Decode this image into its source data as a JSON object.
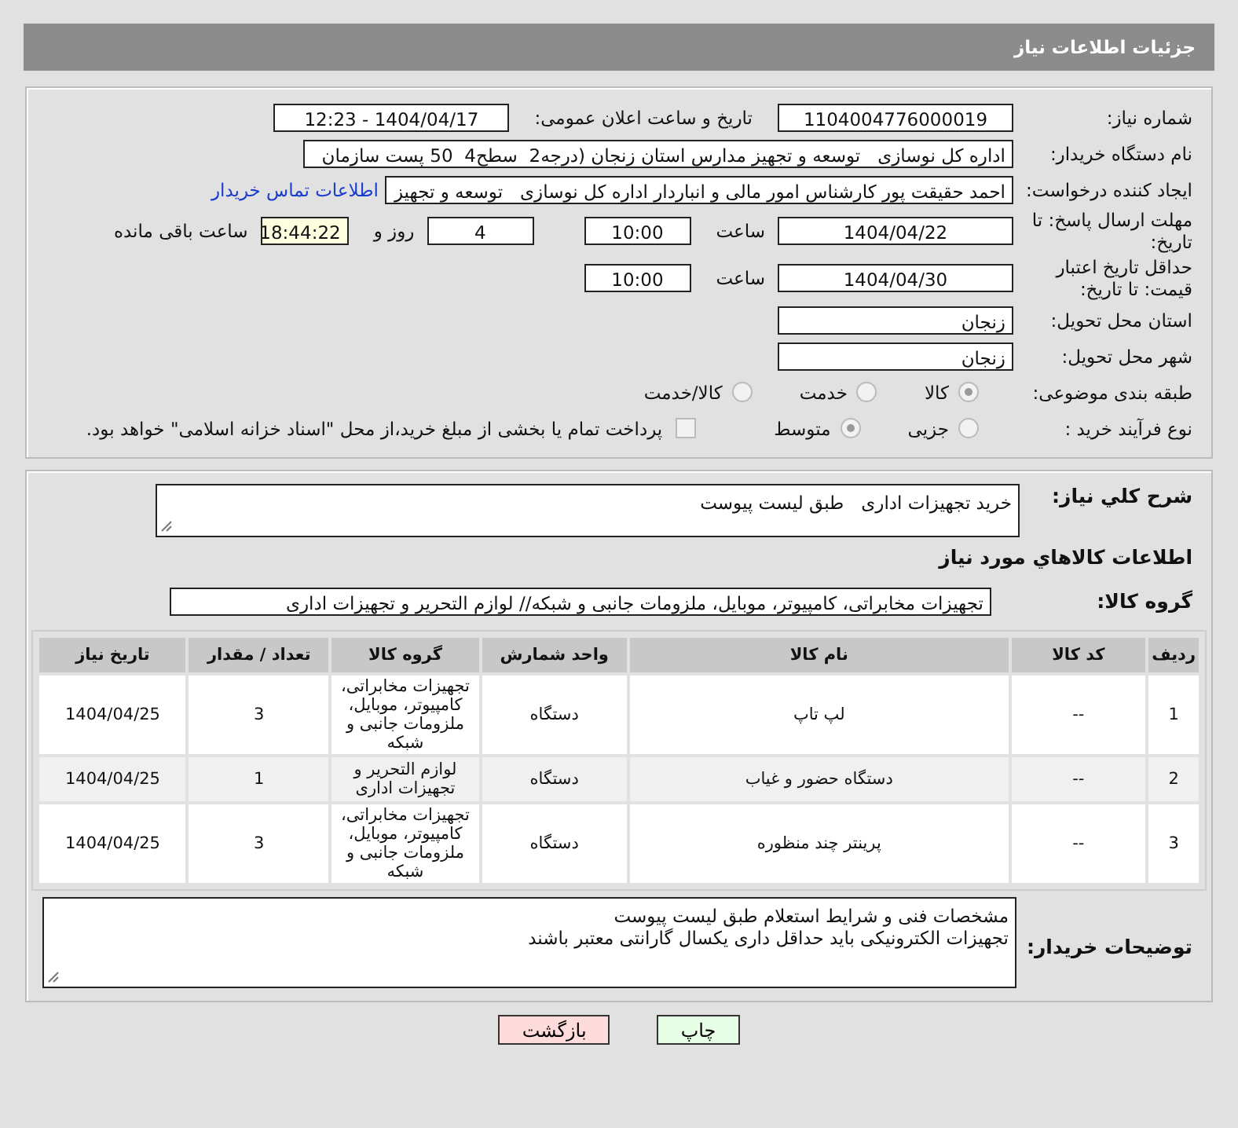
{
  "header": {
    "title": "جزئیات اطلاعات نیاز"
  },
  "need_number": {
    "label": "شماره نیاز:",
    "value": "1104004776000019"
  },
  "announce": {
    "label": "تاریخ و ساعت اعلان عمومی:",
    "value": "1404/04/17 - 12:23"
  },
  "buyer": {
    "label": "نام دستگاه خریدار:",
    "value": "اداره کل نوسازی   توسعه و تجهیز مدارس استان زنجان (درجه2  سطح4  50 پست سازمان"
  },
  "creator": {
    "label": "ایجاد کننده درخواست:",
    "value": "احمد حقیقت پور کارشناس امور مالی و انباردار اداره کل نوسازی   توسعه و تجهیز",
    "link": "اطلاعات تماس خریدار"
  },
  "deadline": {
    "label": "مهلت ارسال پاسخ: تا تاریخ:",
    "date": "1404/04/22",
    "time_label": "ساعت",
    "time": "10:00",
    "days": "4",
    "days_label": "روز و",
    "remaining": "18:44:22",
    "remaining_label": "ساعت باقی مانده"
  },
  "price_validity": {
    "label": "حداقل تاریخ اعتبار قیمت: تا تاریخ:",
    "date": "1404/04/30",
    "time_label": "ساعت",
    "time": "10:00"
  },
  "province": {
    "label": "استان محل تحویل:",
    "value": "زنجان"
  },
  "city": {
    "label": "شهر محل تحویل:",
    "value": "زنجان"
  },
  "category": {
    "label": "طبقه بندی موضوعی:",
    "options": [
      {
        "label": "کالا",
        "selected": true
      },
      {
        "label": "خدمت",
        "selected": false
      },
      {
        "label": "کالا/خدمت",
        "selected": false
      }
    ]
  },
  "process": {
    "label": "نوع فرآیند خرید :",
    "options": [
      {
        "label": "جزیی",
        "selected": false
      },
      {
        "label": "متوسط",
        "selected": true
      }
    ],
    "payment": {
      "checked": false,
      "text": "پرداخت تمام یا بخشی از مبلغ خرید،از محل \"اسناد خزانه اسلامی\" خواهد بود."
    }
  },
  "summary": {
    "label": "شرح کلي نیاز:",
    "value": "خرید تجهیزات اداری   طبق لیست پیوست"
  },
  "goods_title": "اطلاعات کالاهاي مورد نیاز",
  "goods_group": {
    "label": "گروه کالا:",
    "value": "تجهیزات مخابراتی، کامپیوتر، موبایل، ملزومات جانبی و شبکه// لوازم التحریر و تجهیزات اداری"
  },
  "table": {
    "columns": [
      "ردیف",
      "کد کالا",
      "نام کالا",
      "واحد شمارش",
      "گروه کالا",
      "تعداد / مقدار",
      "تاریخ نیاز"
    ],
    "rows": [
      [
        "1",
        "--",
        "لپ تاپ",
        "دستگاه",
        "تجهیزات مخابراتی، کامپیوتر، موبایل، ملزومات جانبی و شبکه",
        "3",
        "1404/04/25"
      ],
      [
        "2",
        "--",
        "دستگاه حضور و غیاب",
        "دستگاه",
        "لوازم التحریر و تجهیزات اداری",
        "1",
        "1404/04/25"
      ],
      [
        "3",
        "--",
        "پرینتر چند منظوره",
        "دستگاه",
        "تجهیزات مخابراتی، کامپیوتر، موبایل، ملزومات جانبی و شبکه",
        "3",
        "1404/04/25"
      ]
    ]
  },
  "buyer_notes": {
    "label": "توضیحات خریدار:",
    "lines": [
      "مشخصات فنی و شرایط استعلام طبق لیست پیوست",
      "تجهیزات الکترونیکی باید حداقل داری یکسال گارانتی معتبر باشند"
    ]
  },
  "buttons": [
    {
      "label": "چاپ",
      "kind": "print"
    },
    {
      "label": "بازگشت",
      "kind": "back"
    }
  ]
}
